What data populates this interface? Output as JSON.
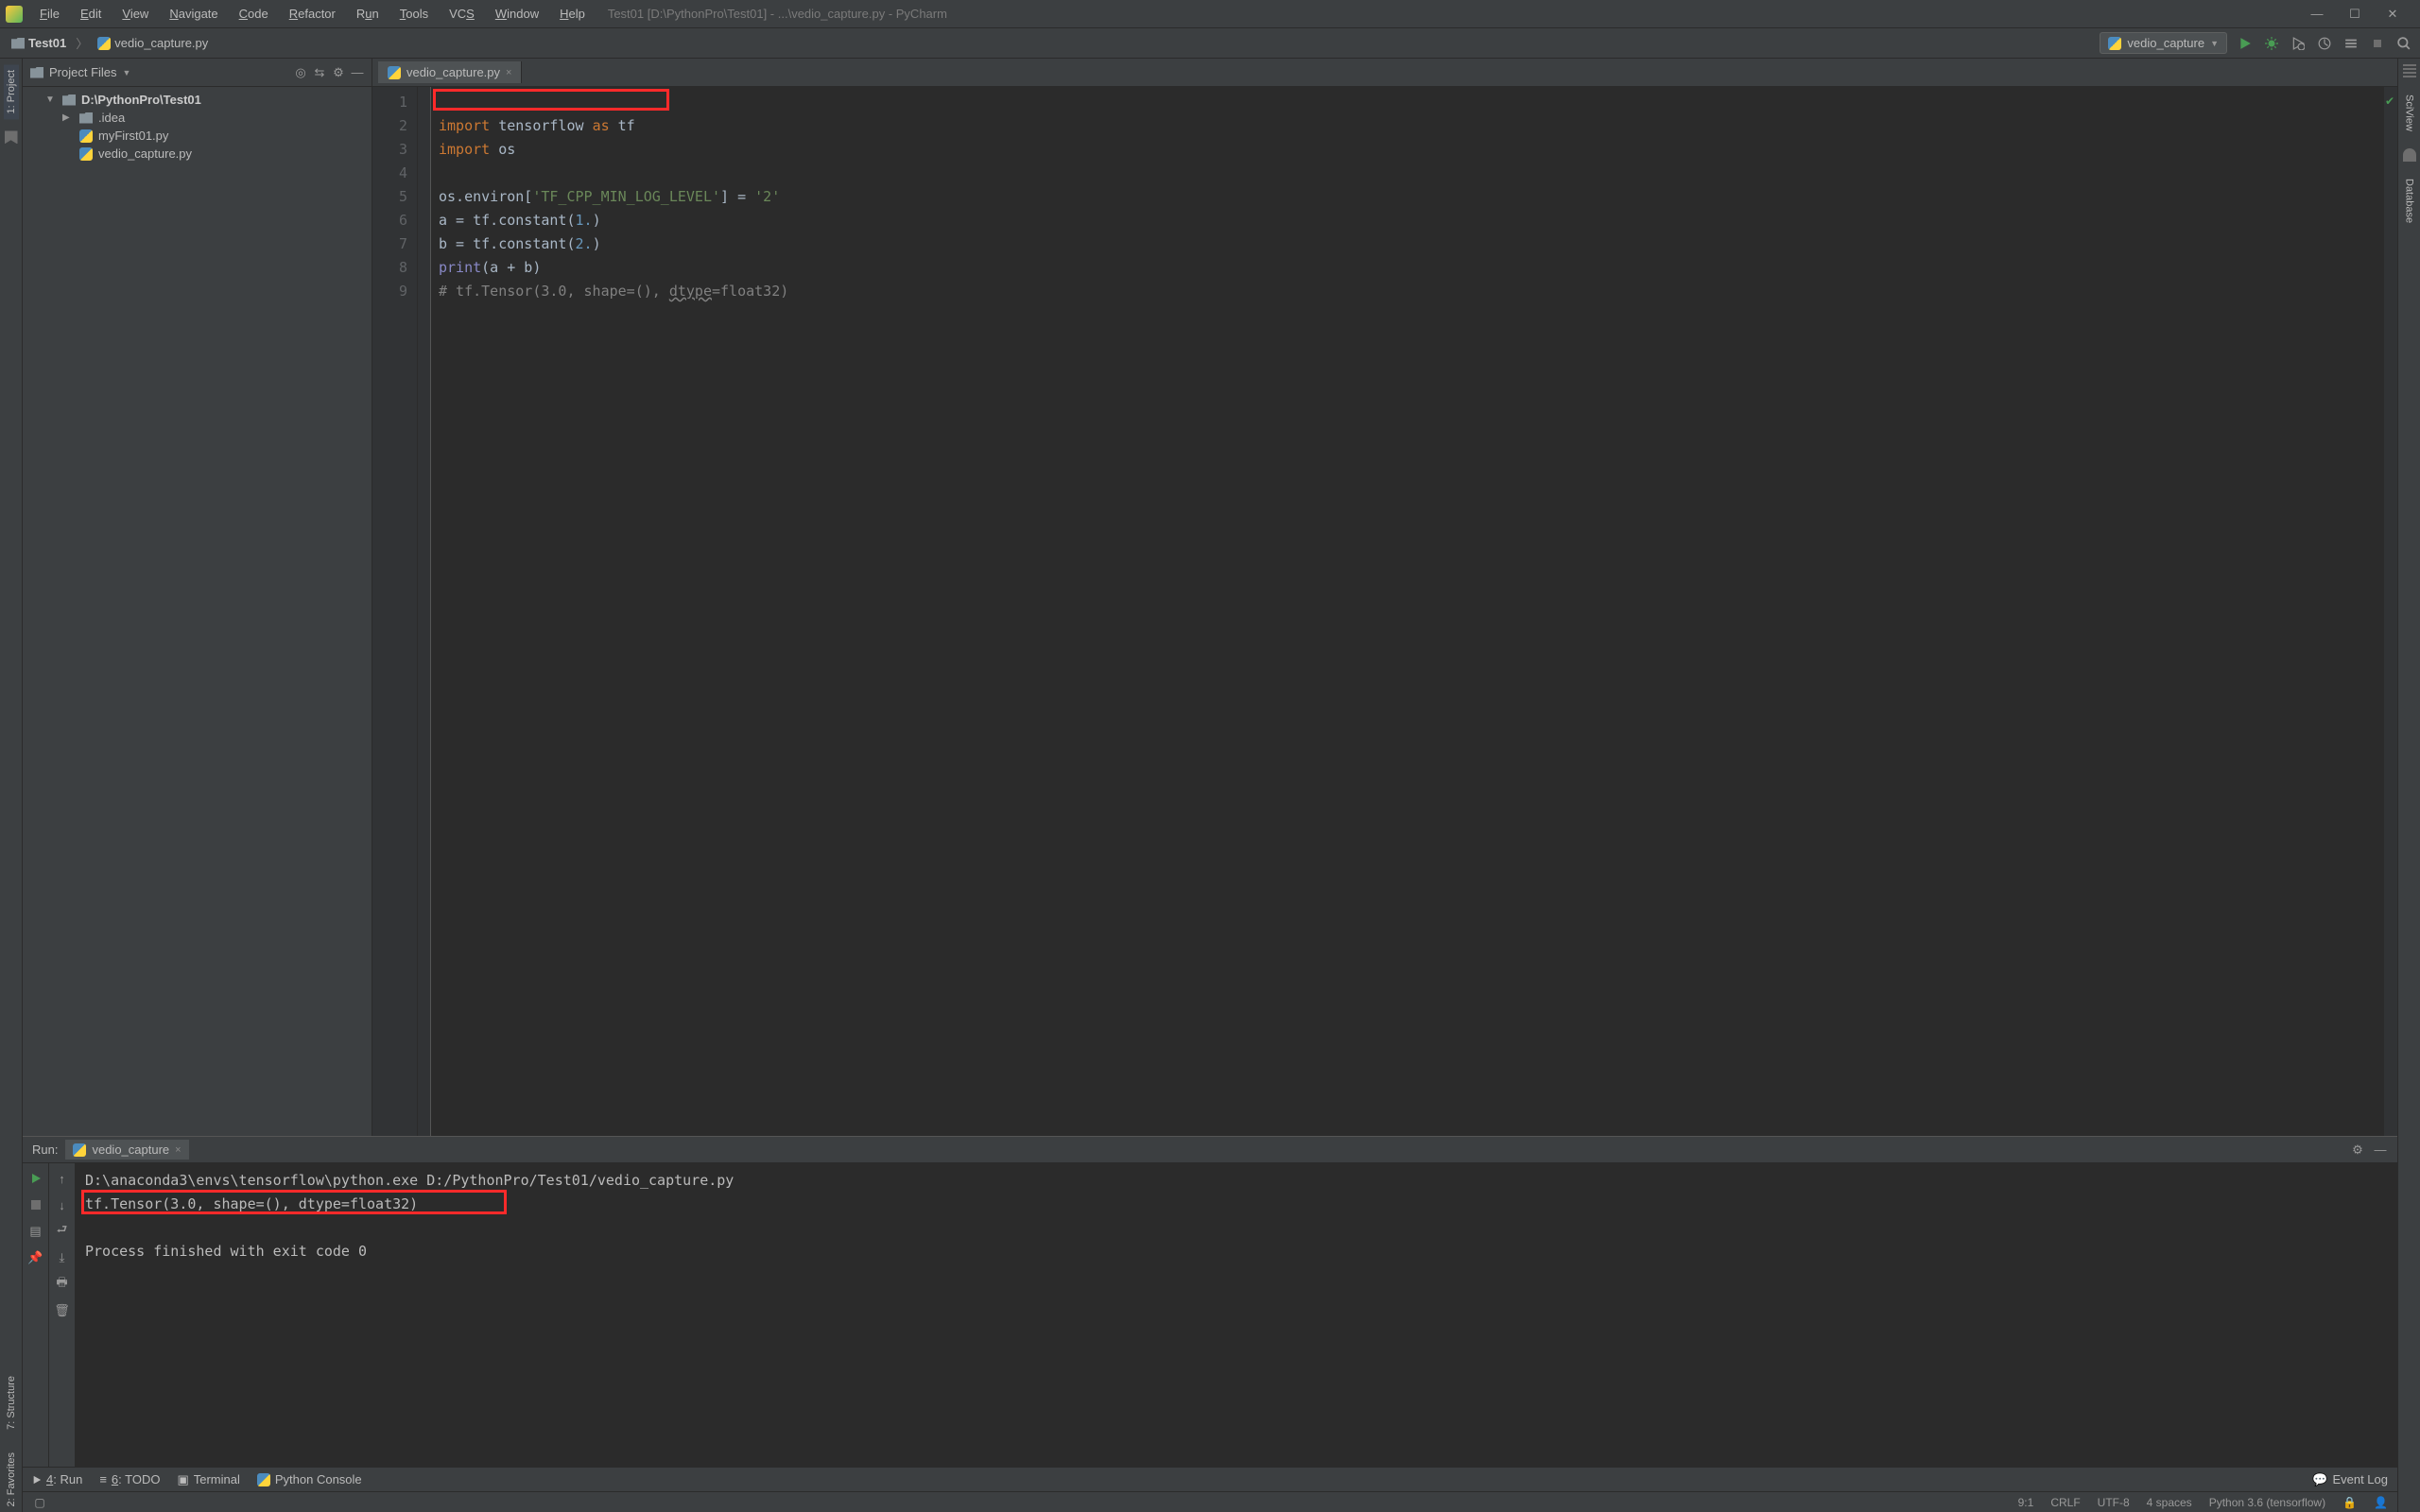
{
  "menus": {
    "file": "File",
    "edit": "Edit",
    "view": "View",
    "navigate": "Navigate",
    "code": "Code",
    "refactor": "Refactor",
    "run": "Run",
    "tools": "Tools",
    "vcs": "VCS",
    "window": "Window",
    "help": "Help"
  },
  "title": "Test01 [D:\\PythonPro\\Test01] - ...\\vedio_capture.py - PyCharm",
  "breadcrumb": {
    "project": "Test01",
    "file": "vedio_capture.py"
  },
  "run_config": {
    "name": "vedio_capture"
  },
  "project_pane": {
    "header": "Project Files",
    "root": "D:\\PythonPro\\Test01",
    "idea": ".idea",
    "file1": "myFirst01.py",
    "file2": "vedio_capture.py"
  },
  "editor_tab": {
    "name": "vedio_capture.py"
  },
  "code_lines": {
    "l1_import": "import",
    "l1_mod": "tensorflow",
    "l1_as": "as",
    "l1_alias": "tf",
    "l2_import": "import",
    "l2_mod": "os",
    "l4_a": "os.environ[",
    "l4_key": "'TF_CPP_MIN_LOG_LEVEL'",
    "l4_b": "] = ",
    "l4_val": "'2'",
    "l5_a": "a = tf.constant(",
    "l5_n": "1.",
    "l5_b": ")",
    "l6_a": "b = tf.constant(",
    "l6_n": "2.",
    "l6_b": ")",
    "l7_fn": "print",
    "l7_args": "(a + b)",
    "l8_a": "# tf.Tensor(3.0, shape=(), ",
    "l8_b": "dtype",
    "l8_c": "=float32)"
  },
  "line_numbers": [
    "1",
    "2",
    "3",
    "4",
    "5",
    "6",
    "7",
    "8",
    "9"
  ],
  "run_panel": {
    "label": "Run:",
    "tab": "vedio_capture",
    "line1": "D:\\anaconda3\\envs\\tensorflow\\python.exe D:/PythonPro/Test01/vedio_capture.py",
    "line2": "tf.Tensor(3.0, shape=(), dtype=float32)",
    "line3": "Process finished with exit code 0"
  },
  "left_tools": {
    "project": "1: Project",
    "structure": "7: Structure",
    "favorites": "2: Favorites"
  },
  "right_tools": {
    "sciview": "SciView",
    "database": "Database"
  },
  "bottom": {
    "run": "4: Run",
    "todo": "6: TODO",
    "terminal": "Terminal",
    "pyconsole": "Python Console",
    "eventlog": "Event Log"
  },
  "status": {
    "pos": "9:1",
    "eol": "CRLF",
    "enc": "UTF-8",
    "indent": "4 spaces",
    "interpreter": "Python 3.6 (tensorflow)"
  }
}
